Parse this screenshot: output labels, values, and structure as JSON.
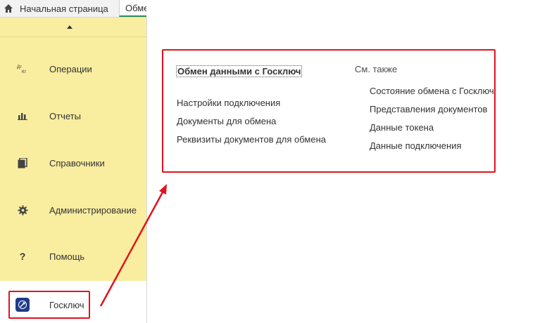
{
  "tabs": {
    "home_label": "Начальная страница",
    "active_label": "Обме"
  },
  "sidebar": {
    "items": [
      {
        "label": "Операции",
        "icon": "debit-credit-icon"
      },
      {
        "label": "Отчеты",
        "icon": "bar-chart-icon"
      },
      {
        "label": "Справочники",
        "icon": "books-icon"
      },
      {
        "label": "Администрирование",
        "icon": "gear-icon"
      },
      {
        "label": "Помощь",
        "icon": "question-icon"
      }
    ],
    "bottom_item": {
      "label": "Госключ",
      "icon": "key-icon"
    },
    "icon_text": {
      "dt": "Дт",
      "kt": "Кт",
      "help": "?"
    }
  },
  "panel": {
    "title": "Обмен данными с Госключ",
    "links": [
      "Настройки подключения",
      "Документы для обмена",
      "Реквизиты документов для обмена"
    ],
    "see_also_label": "См. также",
    "see_also_links": [
      "Состояние обмена с Госключ",
      "Представления документов",
      "Данные токена",
      "Данные подключения"
    ]
  },
  "colors": {
    "sidebar_bg": "#f9eda0",
    "highlight_red": "#e0141e",
    "icon_blue": "#1f3c88",
    "active_tab_underline": "#2e8b57"
  }
}
